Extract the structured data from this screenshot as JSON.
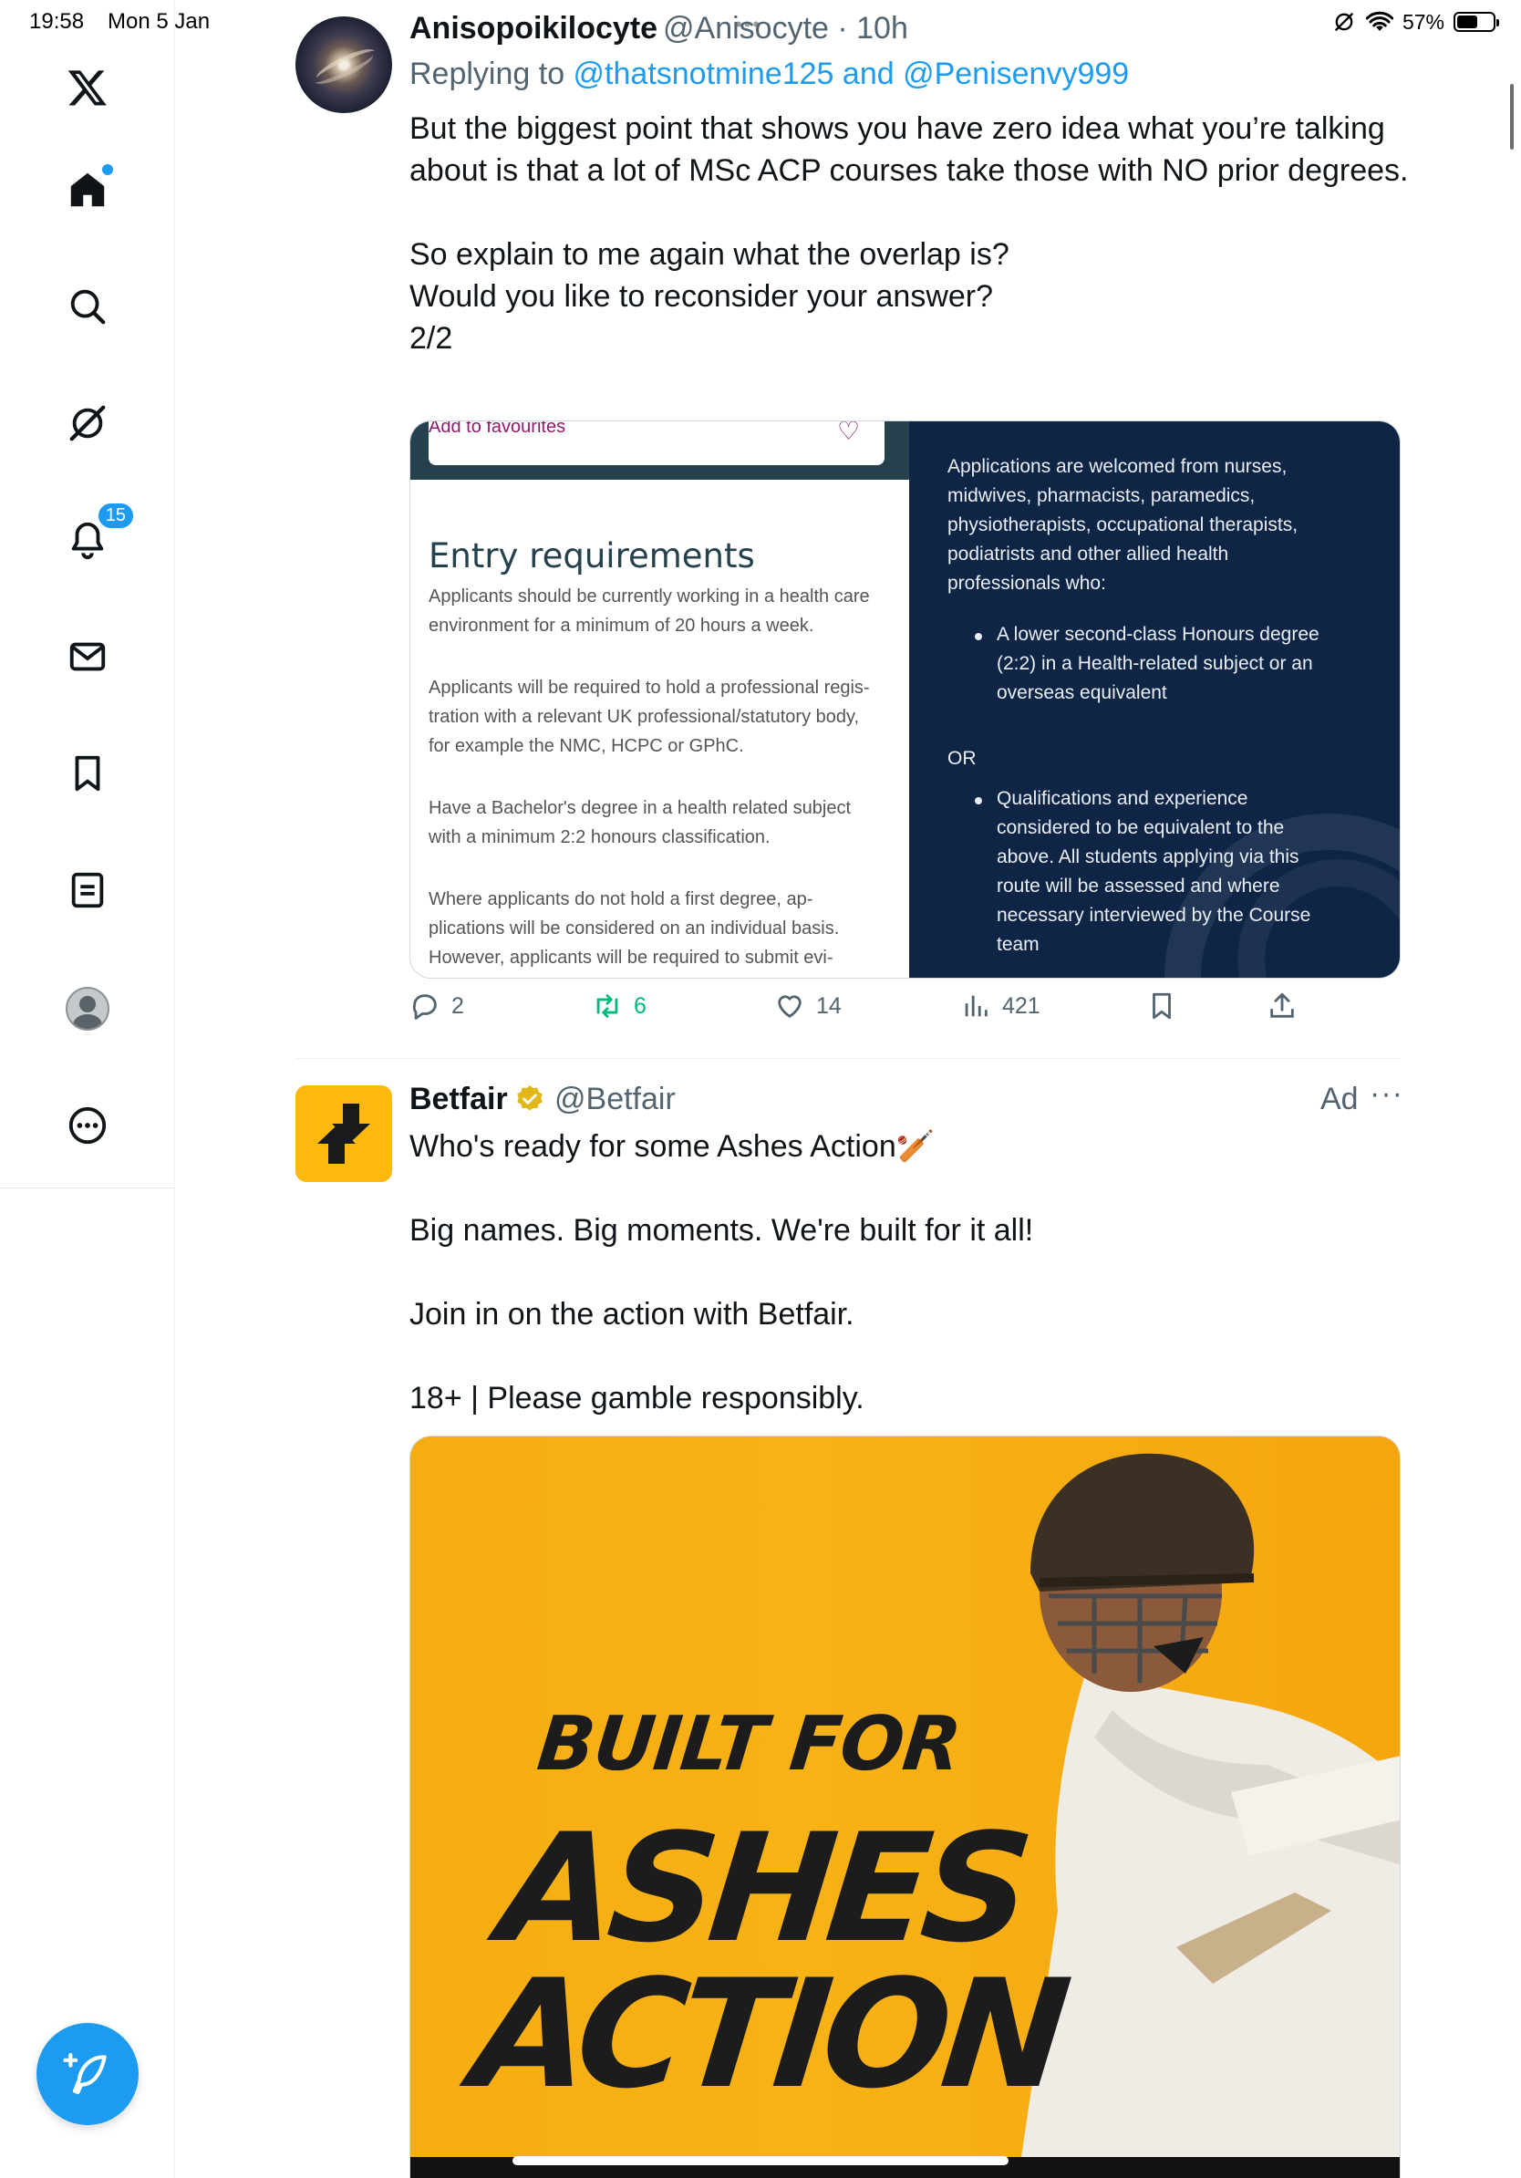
{
  "status_bar": {
    "time": "19:58",
    "date": "Mon 5 Jan",
    "dots": "•••",
    "battery_percent": "57%",
    "battery_level": 0.57
  },
  "sidebar": {
    "logo": "x-logo-icon",
    "items": [
      {
        "name": "home",
        "icon": "home-icon",
        "has_dot": true
      },
      {
        "name": "search",
        "icon": "search-icon"
      },
      {
        "name": "grok",
        "icon": "grok-icon"
      },
      {
        "name": "notifications",
        "icon": "bell-icon",
        "badge": "15"
      },
      {
        "name": "messages",
        "icon": "mail-icon"
      },
      {
        "name": "bookmarks",
        "icon": "bookmark-icon"
      },
      {
        "name": "lists",
        "icon": "list-icon"
      },
      {
        "name": "profile",
        "icon": "avatar-icon"
      },
      {
        "name": "more",
        "icon": "more-icon"
      }
    ],
    "compose_icon": "compose-feather-icon",
    "accent": "#1d9bf0"
  },
  "tweet1": {
    "author_name": "Anisopoikilocyte",
    "author_handle": "@Anisocyte",
    "time": "10h",
    "reply_prefix": "Replying to ",
    "reply_mentions": "@thatsnotmine125 and @Penisenvy999",
    "body": "But the biggest point that shows you have zero idea what you’re talking about is that a lot of MSc ACP courses take those with NO prior degrees.\n\nSo explain to me again what the overlap is?\nWould you like to reconsider your answer?\n2/2",
    "media": {
      "left": {
        "fav_label": "Add to favourites",
        "title": "Entry requirements",
        "p1": "Applicants should be currently working in a health care\nenvironment for a minimum of 20 hours a week.",
        "p2": "Applicants will be required to hold a professional regis-\ntration with a relevant UK professional/statutory body,\nfor example the NMC, HCPC or GPhC.",
        "p3": "Have a Bachelor's degree in a health related subject\nwith a minimum 2:2 honours classification.",
        "p4": "Where applicants do not hold a first degree, ap-\nplications will be considered on an individual basis.\nHowever, applicants will be required to submit evi-"
      },
      "right": {
        "intro": "Applications are welcomed from nurses,\nmidwives, pharmacists, paramedics,\nphysiotherapists, occupational therapists,\npodiatrists and other allied health\nprofessionals who:",
        "bullet1": "A lower second-class Honours degree\n(2:2) in a Health-related subject or an\noverseas equivalent",
        "or": "OR",
        "bullet2": "Qualifications and experience\nconsidered to be equivalent to the\nabove. All students applying via this\nroute will be assessed and where\nnecessary interviewed by the Course\nteam"
      }
    },
    "actions": {
      "replies": "2",
      "reposts": "6",
      "likes": "14",
      "views": "421"
    }
  },
  "tweet2": {
    "author_name": "Betfair",
    "author_handle": "@Betfair",
    "ad_label": "Ad",
    "more": "···",
    "body": "Who's ready for some Ashes Action🏏\n\nBig names. Big moments. We're built for it all!\n\nJoin in on the action with Betfair.\n\n18+ | Please gamble responsibly.",
    "ad_image": {
      "line1": "BUILT FOR",
      "line2": "ASHES",
      "line3": "ACTION"
    },
    "brand_color": "#ffb80c"
  }
}
